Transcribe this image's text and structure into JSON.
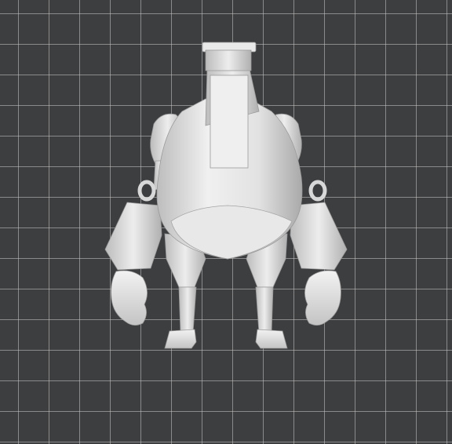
{
  "viewport": {
    "background_color": "#3d3e40",
    "grid_color": "#c8c8c8",
    "model_color": "#e6e6e6"
  },
  "model": {
    "icon": "robot-figure-3d-model"
  }
}
